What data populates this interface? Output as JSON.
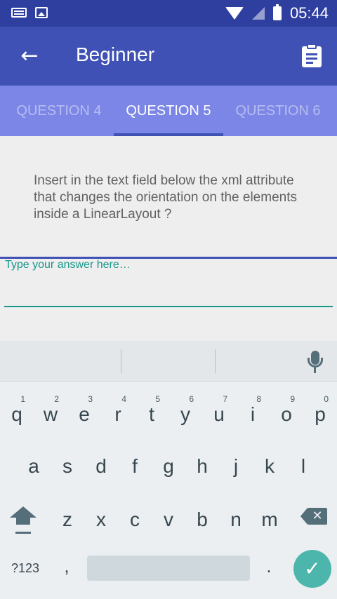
{
  "status_bar": {
    "time": "05:44",
    "icons": [
      "keyboard-icon",
      "image-icon",
      "wifi-icon",
      "signal-icon",
      "battery-charging-icon"
    ]
  },
  "app_bar": {
    "title": "Beginner",
    "back_icon": "arrow-left-icon",
    "action_icon": "clipboard-icon",
    "back_glyph": "←"
  },
  "tabs": [
    {
      "label": "QUESTION 4",
      "active": false
    },
    {
      "label": "QUESTION 5",
      "active": true
    },
    {
      "label": "QUESTION 6",
      "active": false
    }
  ],
  "question": {
    "text": "Insert in the text field below the xml attribute that changes the orientation on the elements inside a LinearLayout ?"
  },
  "answer": {
    "label": "Type your answer here…",
    "value": ""
  },
  "keyboard": {
    "row1": [
      {
        "ch": "q",
        "hint": "1"
      },
      {
        "ch": "w",
        "hint": "2"
      },
      {
        "ch": "e",
        "hint": "3"
      },
      {
        "ch": "r",
        "hint": "4"
      },
      {
        "ch": "t",
        "hint": "5"
      },
      {
        "ch": "y",
        "hint": "6"
      },
      {
        "ch": "u",
        "hint": "7"
      },
      {
        "ch": "i",
        "hint": "8"
      },
      {
        "ch": "o",
        "hint": "9"
      },
      {
        "ch": "p",
        "hint": "0"
      }
    ],
    "row2": [
      "a",
      "s",
      "d",
      "f",
      "g",
      "h",
      "j",
      "k",
      "l"
    ],
    "row3": [
      "z",
      "x",
      "c",
      "v",
      "b",
      "n",
      "m"
    ],
    "symbols_label": "?123",
    "comma": ",",
    "period": ".",
    "enter_glyph": "✓",
    "delete_glyph": "✕"
  },
  "colors": {
    "primary": "#3f51b5",
    "primary_dark": "#2f3fa0",
    "tab_bg": "#7b86e6",
    "accent": "#17968a",
    "enter_key": "#4db6ac"
  }
}
